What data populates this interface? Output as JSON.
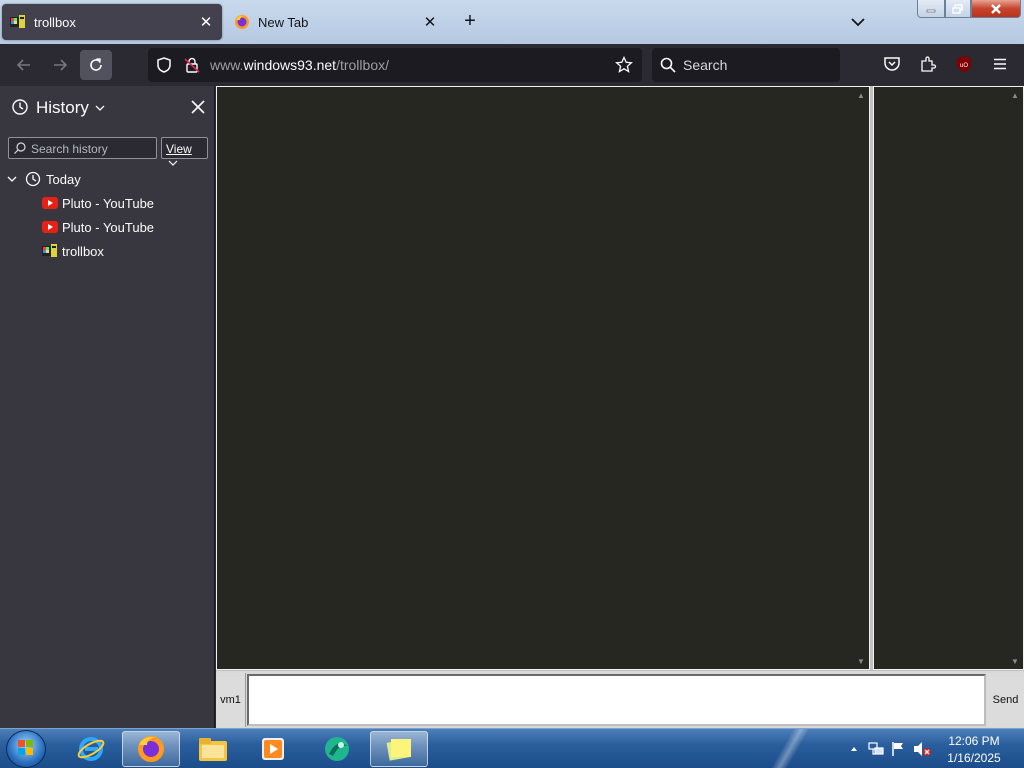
{
  "browser": {
    "tabs": [
      {
        "title": "trollbox",
        "active": true,
        "icon": "windows93-icon"
      },
      {
        "title": "New Tab",
        "active": false,
        "icon": "firefox-icon"
      }
    ],
    "url": {
      "prefix": "www.",
      "host": "windows93.net",
      "path": "/trollbox/"
    },
    "search_placeholder": "Search"
  },
  "sidebar": {
    "title": "History",
    "search_placeholder": "Search history",
    "view_label": "View",
    "group": "Today",
    "items": [
      {
        "title": "Pluto - YouTube",
        "icon": "youtube-icon"
      },
      {
        "title": "Pluto - YouTube",
        "icon": "youtube-icon"
      },
      {
        "title": "trollbox",
        "icon": "windows93-icon"
      }
    ]
  },
  "trollbox": {
    "vm_label": "vm1",
    "send_label": "Send",
    "message_value": ""
  },
  "taskbar": {
    "time": "12:06 PM",
    "date": "1/16/2025",
    "apps": [
      "start",
      "internet-explorer",
      "firefox",
      "file-explorer",
      "media-player",
      "app-green",
      "sticky-notes"
    ]
  },
  "colors": {
    "chrome_dark": "#2b2a33",
    "sidebar_bg": "#38373f",
    "chat_bg": "#272721",
    "taskbar": "#2a5e9d"
  }
}
